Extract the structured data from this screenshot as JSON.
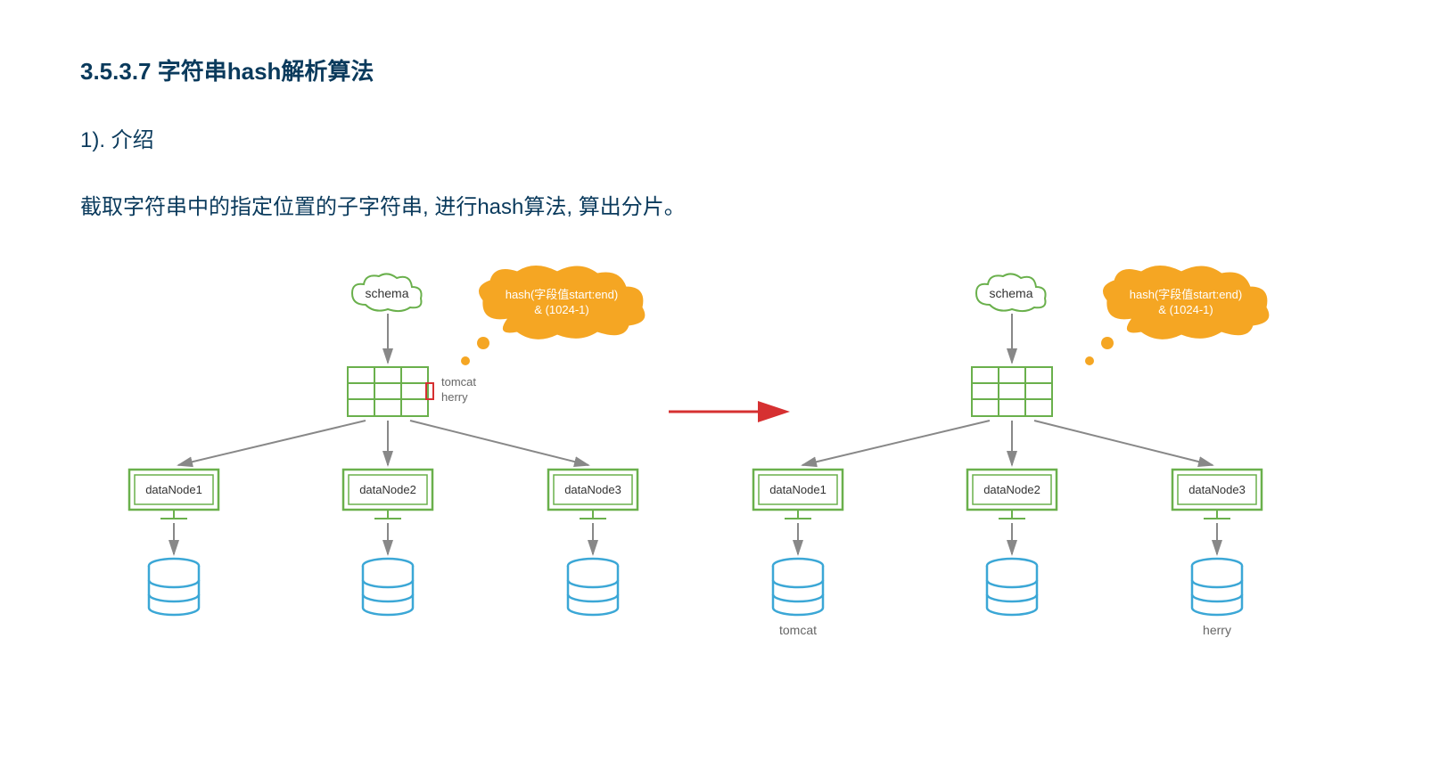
{
  "heading": "3.5.3.7 字符串hash解析算法",
  "subheading": "1). 介绍",
  "description": "截取字符串中的指定位置的子字符串, 进行hash算法,  算出分片。",
  "diagram": {
    "schema_label": "schema",
    "table_labels_left": [
      "tomcat",
      "herry"
    ],
    "cloud_line1": "hash(字段值start:end)",
    "cloud_line2": "& (1024-1)",
    "nodes": [
      "dataNode1",
      "dataNode2",
      "dataNode3"
    ],
    "right_labels": [
      "tomcat",
      "herry"
    ]
  }
}
